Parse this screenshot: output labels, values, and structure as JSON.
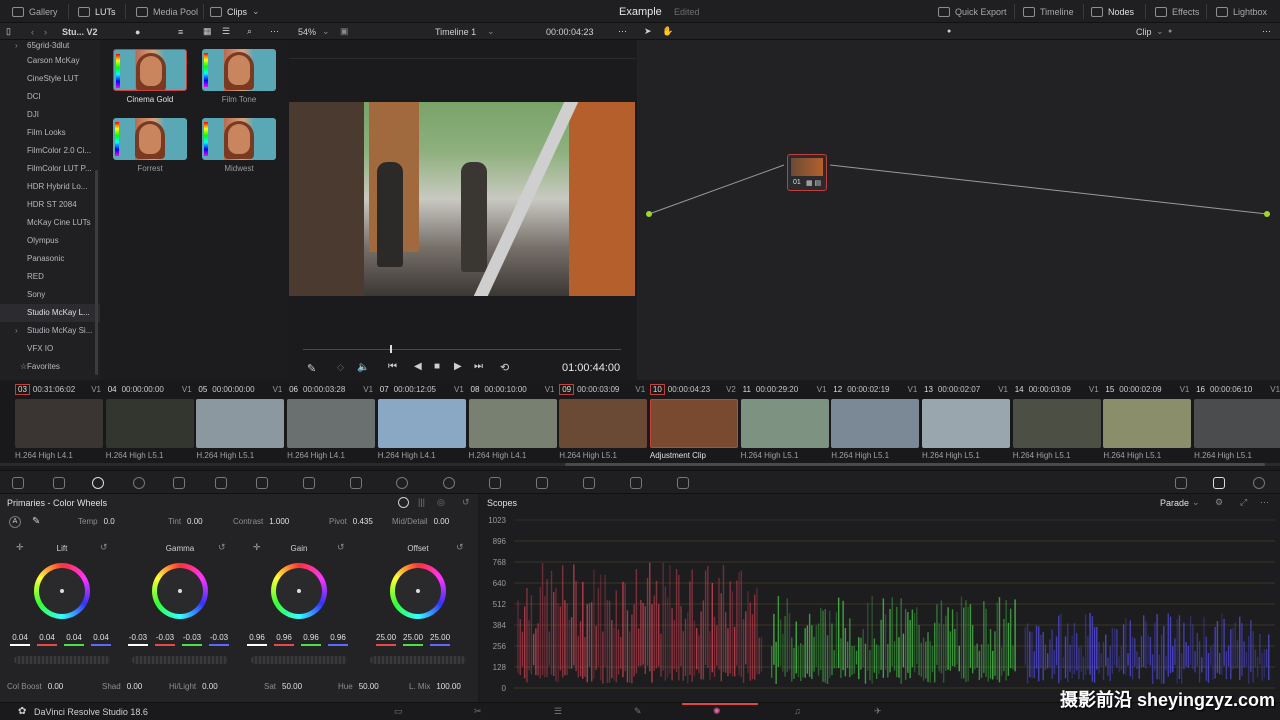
{
  "topbar": {
    "gallery": "Gallery",
    "luts": "LUTs",
    "media_pool": "Media Pool",
    "clips": "Clips",
    "project_title": "Example",
    "edited": "Edited",
    "quick_export": "Quick Export",
    "timeline": "Timeline",
    "nodes": "Nodes",
    "effects": "Effects",
    "lightbox": "Lightbox"
  },
  "toolbar2": {
    "folder": "Stu... V2",
    "zoom": "54%",
    "timeline_name": "Timeline 1",
    "timecode": "00:00:04:23",
    "clip_mode": "Clip"
  },
  "lut_list": {
    "items": [
      "65grid-3dlut",
      "Carson McKay",
      "CineStyle LUT",
      "DCI",
      "DJI",
      "Film Looks",
      "FilmColor 2.0 Ci...",
      "FilmColor LUT P...",
      "HDR Hybrid Lo...",
      "HDR ST 2084",
      "McKay Cine LUTs",
      "Olympus",
      "Panasonic",
      "RED",
      "Sony",
      "Studio McKay L...",
      "Studio McKay Si...",
      "VFX IO",
      "Favorites"
    ],
    "selected_index": 15
  },
  "lut_thumbs": [
    {
      "label": "Cinema Gold"
    },
    {
      "label": "Film Tone"
    },
    {
      "label": "Forrest"
    },
    {
      "label": "Midwest"
    }
  ],
  "viewer": {
    "timecode": "01:00:44:00"
  },
  "node": {
    "label": "01"
  },
  "clips": [
    {
      "num": "03",
      "tc": "00:31:06:02",
      "track": "V1",
      "codec": "H.264 High L4.1",
      "color": "#3a3532",
      "hl": true
    },
    {
      "num": "04",
      "tc": "00:00:00:00",
      "track": "V1",
      "codec": "H.264 High L5.1",
      "color": "#33352f",
      "hl": false
    },
    {
      "num": "05",
      "tc": "00:00:00:00",
      "track": "V1",
      "codec": "H.264 High L5.1",
      "color": "#8c98a0",
      "hl": false
    },
    {
      "num": "06",
      "tc": "00:00:03:28",
      "track": "V1",
      "codec": "H.264 High L4.1",
      "color": "#6a6f70",
      "hl": false
    },
    {
      "num": "07",
      "tc": "00:00:12:05",
      "track": "V1",
      "codec": "H.264 High L4.1",
      "color": "#8aa8c4",
      "hl": false
    },
    {
      "num": "08",
      "tc": "00:00:10:00",
      "track": "V1",
      "codec": "H.264 High L4.1",
      "color": "#788072",
      "hl": false
    },
    {
      "num": "09",
      "tc": "00:00:03:09",
      "track": "V1",
      "codec": "H.264 High L5.1",
      "color": "#6a4a35",
      "hl": true
    },
    {
      "num": "10",
      "tc": "00:00:04:23",
      "track": "V2",
      "codec": "Adjustment Clip",
      "color": "#7a4a30",
      "hl": true
    },
    {
      "num": "11",
      "tc": "00:00:29:20",
      "track": "V1",
      "codec": "H.264 High L5.1",
      "color": "#7d9280",
      "hl": false
    },
    {
      "num": "12",
      "tc": "00:00:02:19",
      "track": "V1",
      "codec": "H.264 High L5.1",
      "color": "#7b8896",
      "hl": false
    },
    {
      "num": "13",
      "tc": "00:00:02:07",
      "track": "V1",
      "codec": "H.264 High L5.1",
      "color": "#9aa6ae",
      "hl": false
    },
    {
      "num": "14",
      "tc": "00:00:03:09",
      "track": "V1",
      "codec": "H.264 High L5.1",
      "color": "#4c4f44",
      "hl": false
    },
    {
      "num": "15",
      "tc": "00:00:02:09",
      "track": "V1",
      "codec": "H.264 High L5.1",
      "color": "#8a8e6a",
      "hl": false
    },
    {
      "num": "16",
      "tc": "00:00:06:10",
      "track": "V1",
      "codec": "H.264 High L5.1",
      "color": "#4a4c4d",
      "hl": false
    }
  ],
  "primaries": {
    "title": "Primaries - Color Wheels",
    "temp_label": "Temp",
    "temp": "0.0",
    "tint_label": "Tint",
    "tint": "0.00",
    "contrast_label": "Contrast",
    "contrast": "1.000",
    "pivot_label": "Pivot",
    "pivot": "0.435",
    "mid_label": "Mid/Detail",
    "mid": "0.00",
    "wheels": [
      {
        "name": "Lift",
        "values": [
          "0.04",
          "0.04",
          "0.04",
          "0.04"
        ]
      },
      {
        "name": "Gamma",
        "values": [
          "-0.03",
          "-0.03",
          "-0.03",
          "-0.03"
        ]
      },
      {
        "name": "Gain",
        "values": [
          "0.96",
          "0.96",
          "0.96",
          "0.96"
        ]
      },
      {
        "name": "Offset",
        "values": [
          "25.00",
          "25.00",
          "25.00"
        ]
      }
    ],
    "colboost_label": "Col Boost",
    "colboost": "0.00",
    "shad_label": "Shad",
    "shad": "0.00",
    "hilight_label": "Hi/Light",
    "hilight": "0.00",
    "sat_label": "Sat",
    "sat": "50.00",
    "hue_label": "Hue",
    "hue": "50.00",
    "lmix_label": "L. Mix",
    "lmix": "100.00"
  },
  "scopes": {
    "title": "Scopes",
    "mode": "Parade",
    "ticks": [
      "1023",
      "896",
      "768",
      "640",
      "512",
      "384",
      "256",
      "128",
      "0"
    ],
    "colors": {
      "red": "#e8485a",
      "green": "#4ee04e",
      "blue": "#5a52ff"
    }
  },
  "status": {
    "app_name": "DaVinci Resolve Studio 18.6"
  },
  "watermark": "摄影前沿 sheyingzyz.com"
}
